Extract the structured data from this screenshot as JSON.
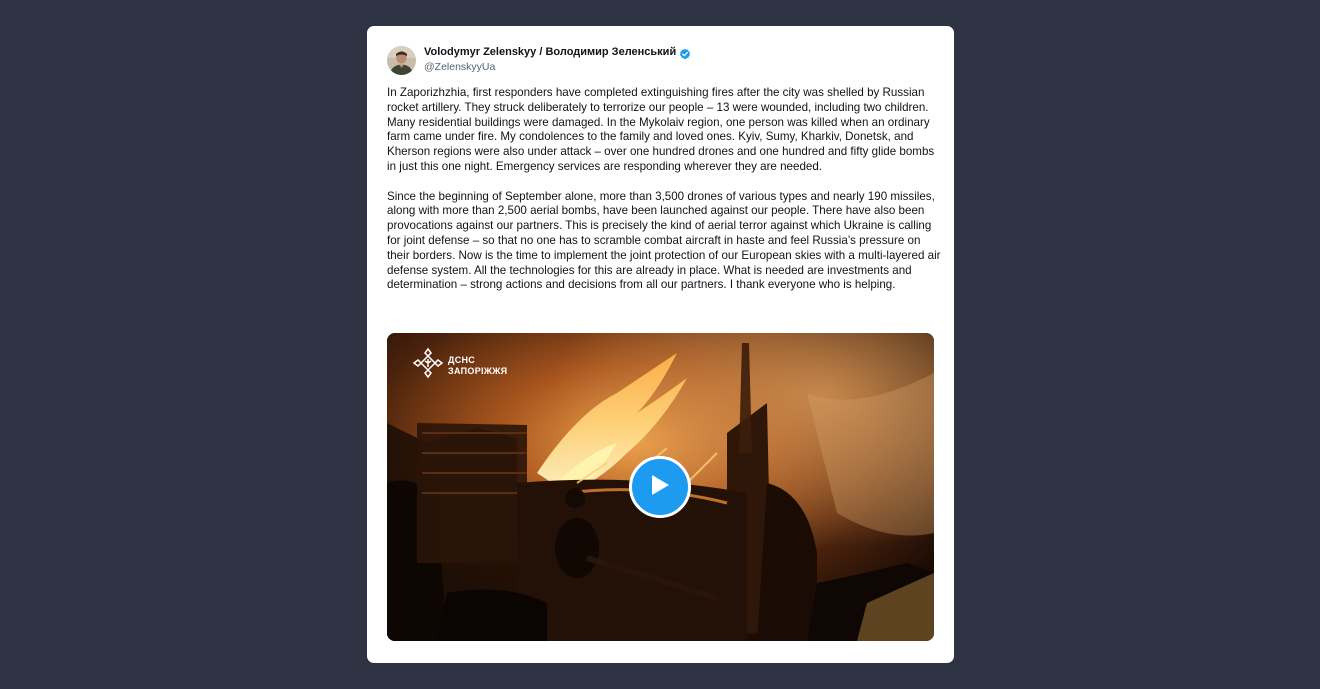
{
  "tweet": {
    "author": {
      "display_name": "Volodymyr Zelenskyy / Володимир Зеленський",
      "handle": "@ZelenskyyUa",
      "verified": true,
      "verified_color": "#1d9bf0"
    },
    "text": "In Zaporizhzhia, first responders have completed extinguishing fires after the city was shelled by Russian rocket artillery. They struck deliberately to terrorize our people – 13 were wounded, including two children. Many residential buildings were damaged. In the Mykolaiv region, one person was killed when an ordinary farm came under fire. My condolences to the family and loved ones. Kyiv, Sumy, Kharkiv, Donetsk, and Kherson regions were also under attack – over one hundred drones and one hundred and fifty glide bombs in just this one night. Emergency services are responding wherever they are needed.\n\nSince the beginning of September alone, more than 3,500 drones of various types and nearly 190 missiles, along with more than 2,500 aerial bombs, have been launched against our people. There have also been provocations against our partners. This is precisely the kind of aerial terror against which Ukraine is calling for joint defense – so that no one has to scramble combat aircraft in haste and feel Russia’s pressure on their borders. Now is the time to implement the joint protection of our European skies with a multi-layered air defense system. All the technologies for this are already in place. What is needed are investments and determination – strong actions and decisions from all our partners. I thank everyone who is helping.",
    "media": {
      "type": "video",
      "watermark_line1": "ДСНС",
      "watermark_line2": "ЗАПОРІЖЖЯ",
      "play_icon": "play-icon",
      "play_color": "#1d9bf0"
    }
  },
  "colors": {
    "background": "#2e3343",
    "card": "#ffffff"
  }
}
